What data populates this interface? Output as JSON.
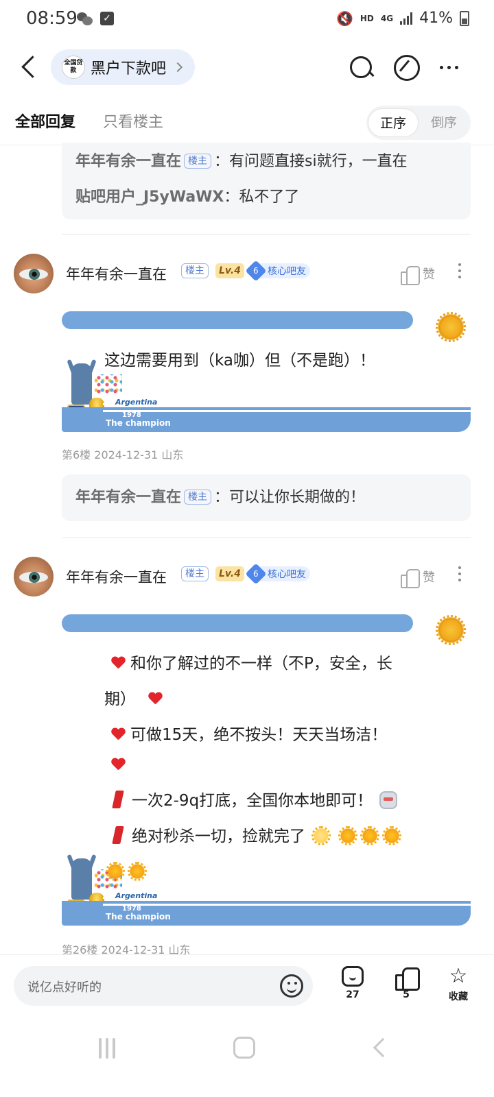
{
  "status_bar": {
    "time": "08:59",
    "icons_left": [
      "wechat-icon",
      "checkbox-icon"
    ],
    "hd": "HD",
    "network": "4G",
    "battery": "41%"
  },
  "nav": {
    "forum_logo_text": "全国贷款",
    "forum_name": "黑户下款吧"
  },
  "tabs": {
    "all": "全部回复",
    "owner_only": "只看楼主",
    "order_asc": "正序",
    "order_desc": "倒序"
  },
  "top_replies": [
    {
      "name": "年年有余一直在",
      "badge": "楼主",
      "text": "：有问题直接si就行，一直在"
    },
    {
      "name": "贴吧用户_J5yWaWX",
      "text": "：私不了了"
    }
  ],
  "posts": [
    {
      "author": "年年有余一直在",
      "owner_badge": "楼主",
      "level": "Lv.4",
      "core_level": "6",
      "core_label": "核心吧友",
      "like_label": "赞",
      "text": "这边需要用到（ka咖）但（不是跑）！",
      "frame": {
        "argentina": "Argentina",
        "year": "1978",
        "champion": "The champion"
      },
      "meta": "第6楼  2024-12-31  山东",
      "reply": {
        "name": "年年有余一直在",
        "badge": "楼主",
        "text": "：可以让你长期做的！"
      }
    },
    {
      "author": "年年有余一直在",
      "owner_badge": "楼主",
      "level": "Lv.4",
      "core_level": "6",
      "core_label": "核心吧友",
      "like_label": "赞",
      "lines": [
        "和你了解过的不一样（不P，安全，长",
        "期）",
        "可做15天，绝不按头！天天当场洁！",
        "一次2-9q打底，全国你本地即可！",
        "绝对秒杀一切，捡就完了"
      ],
      "frame": {
        "argentina": "Argentina",
        "year": "1978",
        "champion": "The champion"
      },
      "meta": "第26楼  2024-12-31  山东"
    }
  ],
  "bottom_bar": {
    "placeholder": "说亿点好听的",
    "comments": "27",
    "likes": "5",
    "favorite": "收藏"
  }
}
